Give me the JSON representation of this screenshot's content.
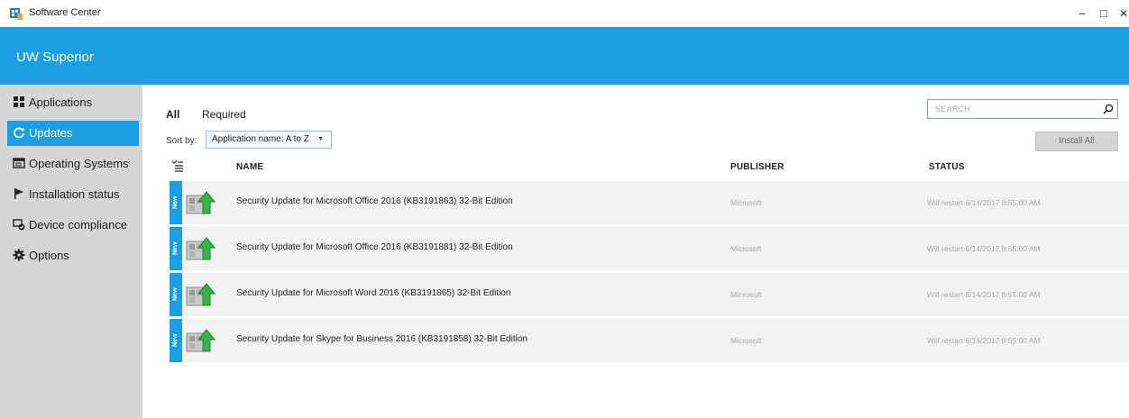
{
  "window": {
    "title": "Software Center",
    "controls": {
      "minimize": "−",
      "maximize": "□",
      "close": "✕"
    }
  },
  "banner": {
    "org_name": "UW Superior"
  },
  "sidebar": {
    "items": [
      {
        "label": "Applications",
        "icon": "applications-grid-icon",
        "active": false
      },
      {
        "label": "Updates",
        "icon": "refresh-icon",
        "active": true
      },
      {
        "label": "Operating Systems",
        "icon": "os-window-icon",
        "active": false
      },
      {
        "label": "Installation status",
        "icon": "flag-icon",
        "active": false
      },
      {
        "label": "Device compliance",
        "icon": "compliance-icon",
        "active": false
      },
      {
        "label": "Options",
        "icon": "gear-icon",
        "active": false
      }
    ]
  },
  "main": {
    "filters": [
      {
        "label": "All",
        "active": true
      },
      {
        "label": "Required",
        "active": false
      }
    ],
    "sort": {
      "label": "Sort by:",
      "selected": "Application name: A to Z"
    },
    "search": {
      "placeholder": "SEARCH",
      "value": ""
    },
    "install_all_label": "Install All",
    "columns": {
      "name": "NAME",
      "publisher": "PUBLISHER",
      "status": "STATUS"
    },
    "rows": [
      {
        "badge": "New",
        "name": "Security Update for Microsoft Office 2016 (KB3191863) 32-Bit Edition",
        "publisher": "Microsoft",
        "status": "Will restart 6/14/2017 8:55:00 AM"
      },
      {
        "badge": "New",
        "name": "Security Update for Microsoft Office 2016 (KB3191881) 32-Bit Edition",
        "publisher": "Microsoft",
        "status": "Will restart 6/14/2017 8:55:00 AM"
      },
      {
        "badge": "New",
        "name": "Security Update for Microsoft Word 2016 (KB3191865) 32-Bit Edition",
        "publisher": "Microsoft",
        "status": "Will restart 6/14/2017 8:55:00 AM"
      },
      {
        "badge": "New",
        "name": "Security Update for Skype for Business 2016 (KB3191858) 32-Bit Edition",
        "publisher": "Microsoft",
        "status": "Will restart 6/14/2017 8:55:00 AM"
      }
    ]
  },
  "colors": {
    "accent": "#1c9ee3",
    "sidebar_bg": "#d6d6d6",
    "row_bg": "#f2f2f2",
    "muted_text": "#aaaaaa"
  }
}
